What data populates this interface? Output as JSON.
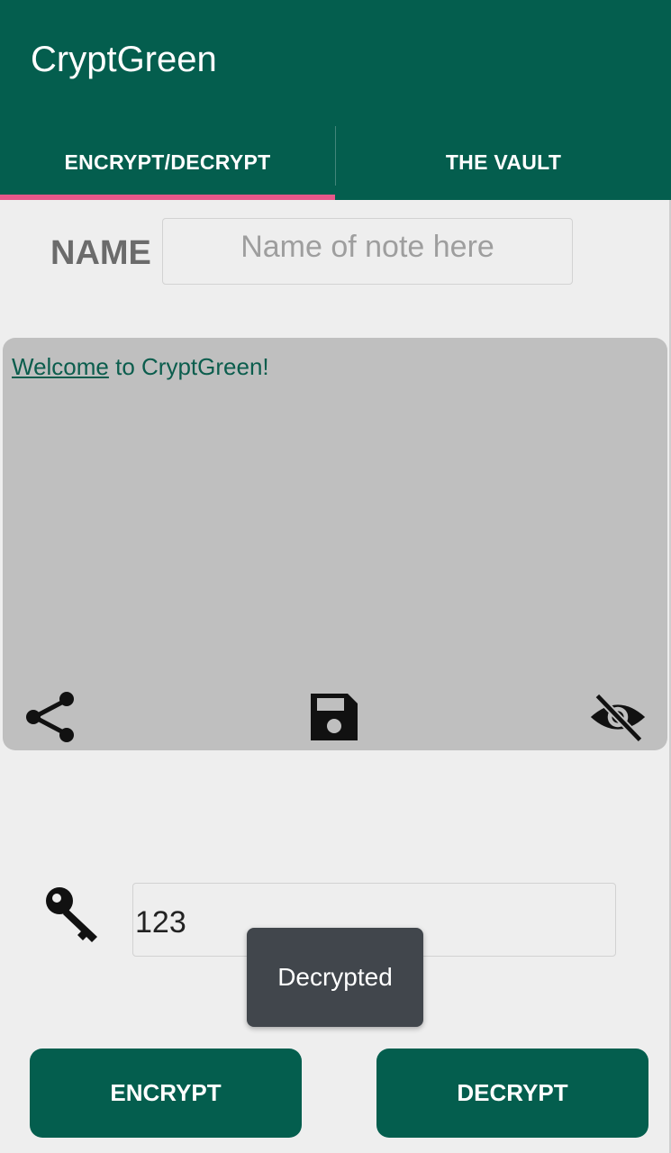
{
  "app": {
    "title": "CryptGreen",
    "accent": "#045e4e",
    "indicator_color": "#e8578a"
  },
  "tabs": [
    {
      "label": "ENCRYPT/DECRYPT",
      "selected": true
    },
    {
      "label": "THE VAULT",
      "selected": false
    }
  ],
  "note": {
    "name_label": "NAME",
    "name_placeholder": "Name of note here",
    "name_value": "",
    "body_link": "Welcome",
    "body_rest": " to CryptGreen!"
  },
  "note_actions": {
    "share_icon": "share-icon",
    "save_icon": "save-icon",
    "visibility_icon": "visibility-off-icon"
  },
  "key": {
    "icon": "key-icon",
    "value": "123"
  },
  "toast": {
    "text": "Decrypted"
  },
  "buttons": {
    "encrypt": "ENCRYPT",
    "decrypt": "DECRYPT"
  }
}
